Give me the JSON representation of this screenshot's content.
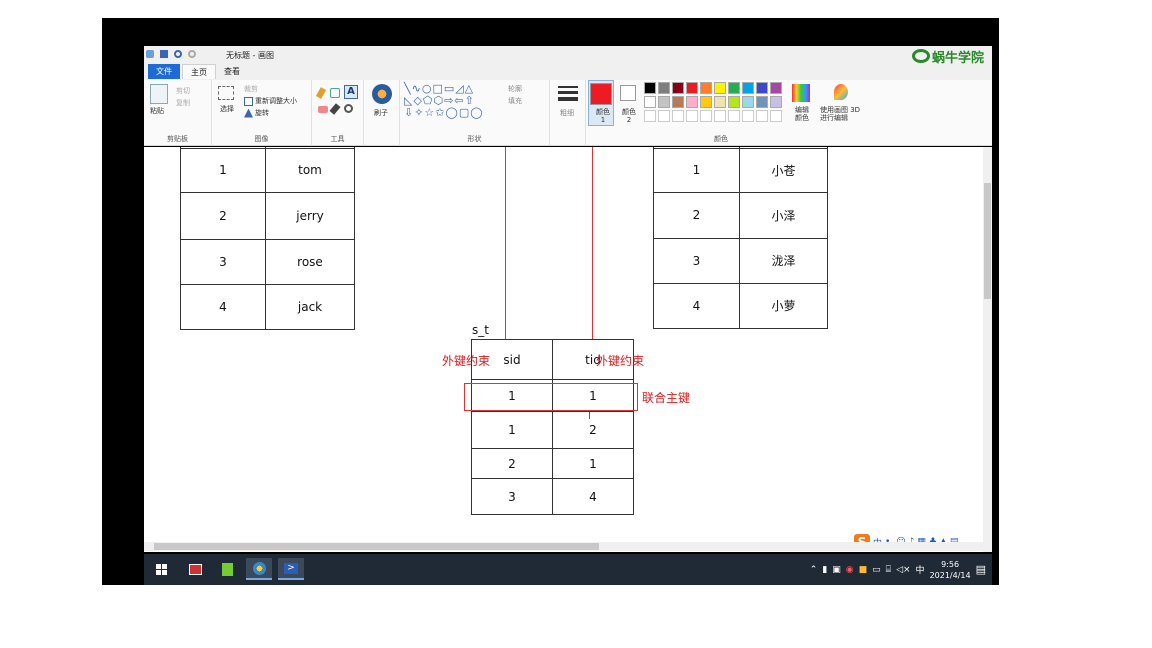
{
  "window": {
    "title": "无标题 - 画图",
    "logo_text": "蜗牛学院"
  },
  "tabs": [
    "文件",
    "主页",
    "查看"
  ],
  "ribbon": {
    "clipboard": {
      "paste": "粘贴",
      "cut": "剪切",
      "copy": "复制",
      "label": "剪贴板"
    },
    "image": {
      "select": "选择",
      "crop": "裁剪",
      "resize": "重新调整大小",
      "rotate": "旋转",
      "label": "图像"
    },
    "tools": {
      "label": "工具"
    },
    "brushes": {
      "label": "刷子"
    },
    "shapes": {
      "outline": "轮廓",
      "fill": "填充",
      "label": "形状"
    },
    "size": {
      "label": "粗细"
    },
    "colors": {
      "color1": "颜色 1",
      "color2": "颜色 2",
      "edit": "编辑颜色",
      "label": "颜色",
      "paint3d": "使用画图 3D 进行编辑",
      "palette_row1": [
        "#000000",
        "#7f7f7f",
        "#880015",
        "#ed1c24",
        "#ff7f27",
        "#fff200",
        "#22b14c",
        "#00a2e8",
        "#3f48cc",
        "#a349a4"
      ],
      "palette_row2": [
        "#ffffff",
        "#c3c3c3",
        "#b97a57",
        "#ffaec9",
        "#ffc90e",
        "#efe4b0",
        "#b5e61d",
        "#99d9ea",
        "#7092be",
        "#c8bfe7"
      ],
      "primary": "#ed1c24",
      "secondary": "#ffffff"
    }
  },
  "canvas": {
    "students": {
      "rows": [
        {
          "id": "1",
          "name": "tom"
        },
        {
          "id": "2",
          "name": "jerry"
        },
        {
          "id": "3",
          "name": "rose"
        },
        {
          "id": "4",
          "name": "jack"
        }
      ]
    },
    "teachers": {
      "rows": [
        {
          "id": "1",
          "name": "小苍"
        },
        {
          "id": "2",
          "name": "小泽"
        },
        {
          "id": "3",
          "name": "泷泽"
        },
        {
          "id": "4",
          "name": "小萝"
        }
      ]
    },
    "st": {
      "title": "s_t",
      "headers": [
        "sid",
        "tid"
      ],
      "rows": [
        [
          "1",
          "1"
        ],
        [
          "1",
          "2"
        ],
        [
          "2",
          "1"
        ],
        [
          "3",
          "4"
        ]
      ]
    },
    "annotations": {
      "fk_left": "外键约束",
      "fk_right": "外键约束",
      "composite_pk": "联合主键"
    },
    "accent_red": "#d32020"
  },
  "ime": {
    "mode": "中"
  },
  "taskbar": {
    "tray_lang": "中",
    "time": "9:56",
    "date": "2021/4/14"
  }
}
